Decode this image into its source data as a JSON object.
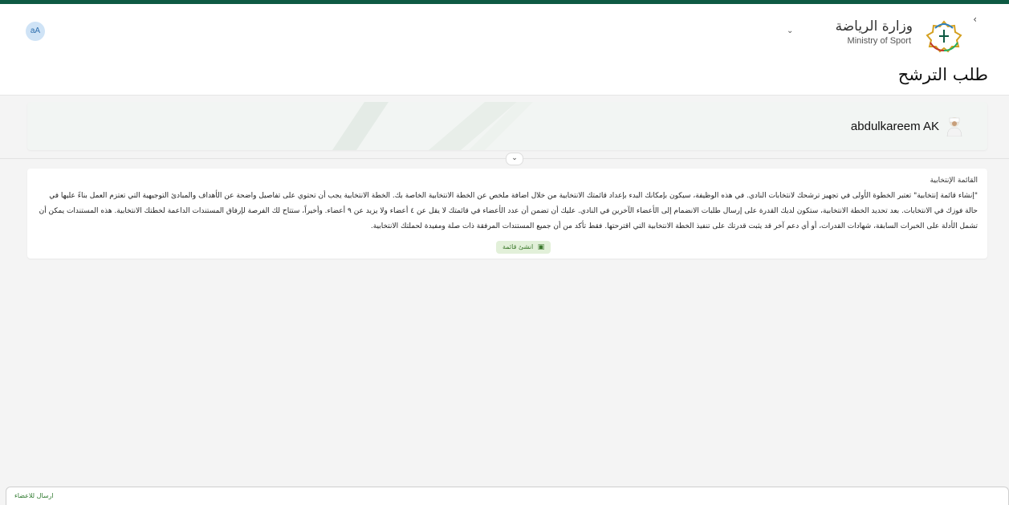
{
  "header": {
    "logo_ar": "وزارة الرياضة",
    "logo_en": "Ministry of Sport",
    "back_icon": "chevron-left-icon",
    "dropdown_icon": "chevron-down-icon",
    "avatar_initials": "aA"
  },
  "page": {
    "title": "طلب الترشح"
  },
  "user": {
    "name": "abdulkareem AK",
    "avatar_icon": "user-avatar-icon"
  },
  "toggle": {
    "icon": "chevron-down-icon"
  },
  "list": {
    "heading": "القائمة الإنتخابية",
    "description": "\"إنشاء قائمة إنتخابية\" تعتبر الخطوة الأولى في تجهيز ترشحك لانتخابات النادي. في هذه الوظيفة، سيكون بإمكانك البدء بإعداد قائمتك الانتخابية من خلال اضافة ملخص عن الخطة الانتخابية الخاصة بك. الخطة الانتخابية يجب أن تحتوي على تفاصيل واضحة عن الأهداف والمبادئ التوجيهية التي تعتزم العمل بناءً عليها في حالة فوزك في الانتخابات. بعد تحديد الخطة الانتخابية، ستكون لديك القدرة على إرسال طلبات الانضمام إلى الأعضاء الآخرين في النادي. عليك أن تضمن أن عدد الأعضاء في قائمتك لا يقل عن ٤ أعضاء ولا يزيد عن ٩ أعضاء. وأخيراً، ستتاح لك الفرصة لإرفاق المستندات الداعمة لخطتك الانتخابية. هذه المستندات يمكن أن تشمل الأدلة على الخبرات السابقة، شهادات القدرات، أو أي دعم آخر قد يثبت قدرتك على تنفيذ الخطة الانتخابية التي اقترحتها. فقط تأكد من أن جميع المستندات المرفقة ذات صلة ومفيدة لحملتك الانتخابية.",
    "create_button_label": "انشئ قائمة",
    "create_button_icon": "create-list-icon"
  },
  "footer": {
    "send_members_label": "ارسال للاعضاء"
  },
  "colors": {
    "brand_dark_green": "#0e5a43",
    "button_bg": "#e2f0d9",
    "button_text": "#3d7a2e",
    "avatar_bg": "#cfe3f6"
  }
}
